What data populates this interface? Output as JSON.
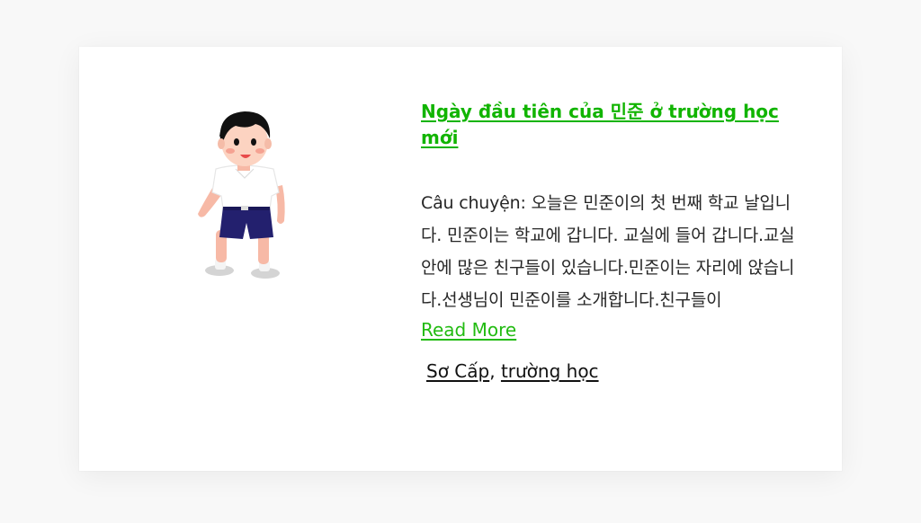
{
  "post": {
    "title": "Ngày đầu tiên của 민준 ở trường học mới",
    "excerpt": "Câu chuyện: 오늘은 민준이의 첫 번째 학교 날입니다. 민준이는 학교에 갑니다. 교실에 들어 갑니다.교실 안에 많은 친구들이 있습니다.민준이는 자리에 앉습니다.선생님이 민준이를 소개합니다.친구들이",
    "read_more_label": "Read More",
    "tags": [
      "Sơ Cấp",
      "trường học"
    ],
    "tag_separator": ",",
    "illustration": "boy-student-illustration"
  },
  "colors": {
    "accent": "#11b400",
    "link": "#22bb11",
    "text": "#262626",
    "uniform_shirt": "#ffffff",
    "uniform_shorts": "#23206e"
  }
}
